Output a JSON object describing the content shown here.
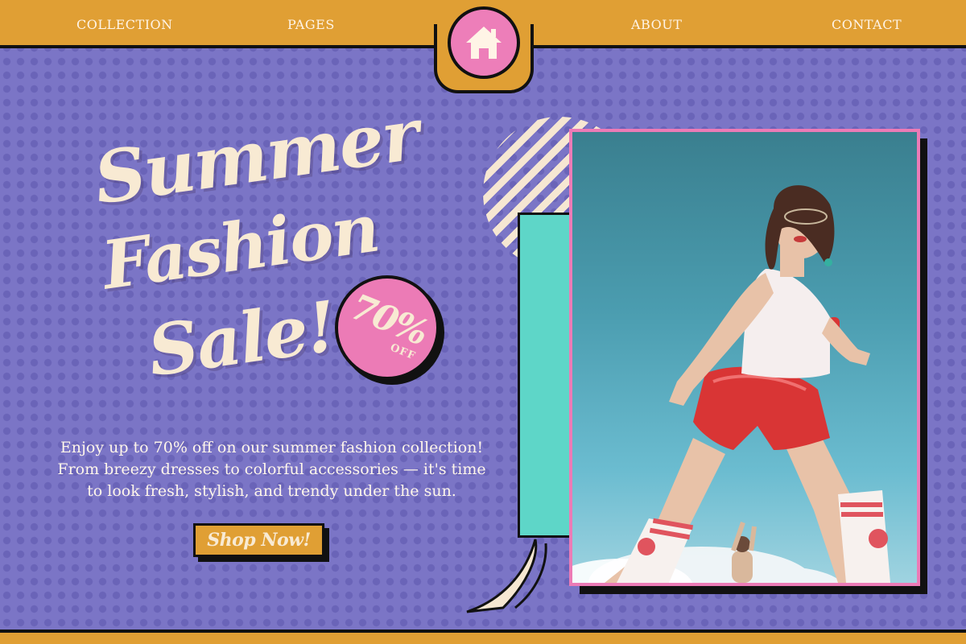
{
  "nav": {
    "items": [
      {
        "label": "COLLECTION"
      },
      {
        "label": "PAGES"
      },
      {
        "label": "ABOUT"
      },
      {
        "label": "CONTACT"
      }
    ],
    "home_icon": "home-icon"
  },
  "hero": {
    "title_line1": "Summer",
    "title_line2": "Fashion",
    "title_line3": "Sale!",
    "badge_percent": "70%",
    "badge_off": "OFF",
    "description_line1": "Enjoy up to 70% off on our summer fashion collection!",
    "description_line2": "From breezy dresses to colorful accessories — it's time",
    "description_line3": "to look fresh, stylish, and trendy under the sun.",
    "cta_label": "Shop Now!"
  },
  "colors": {
    "background": "#7b75c6",
    "accent_orange": "#e09f34",
    "accent_pink": "#ec7bb6",
    "accent_teal": "#5ed6c8",
    "cream": "#f8ead3"
  }
}
